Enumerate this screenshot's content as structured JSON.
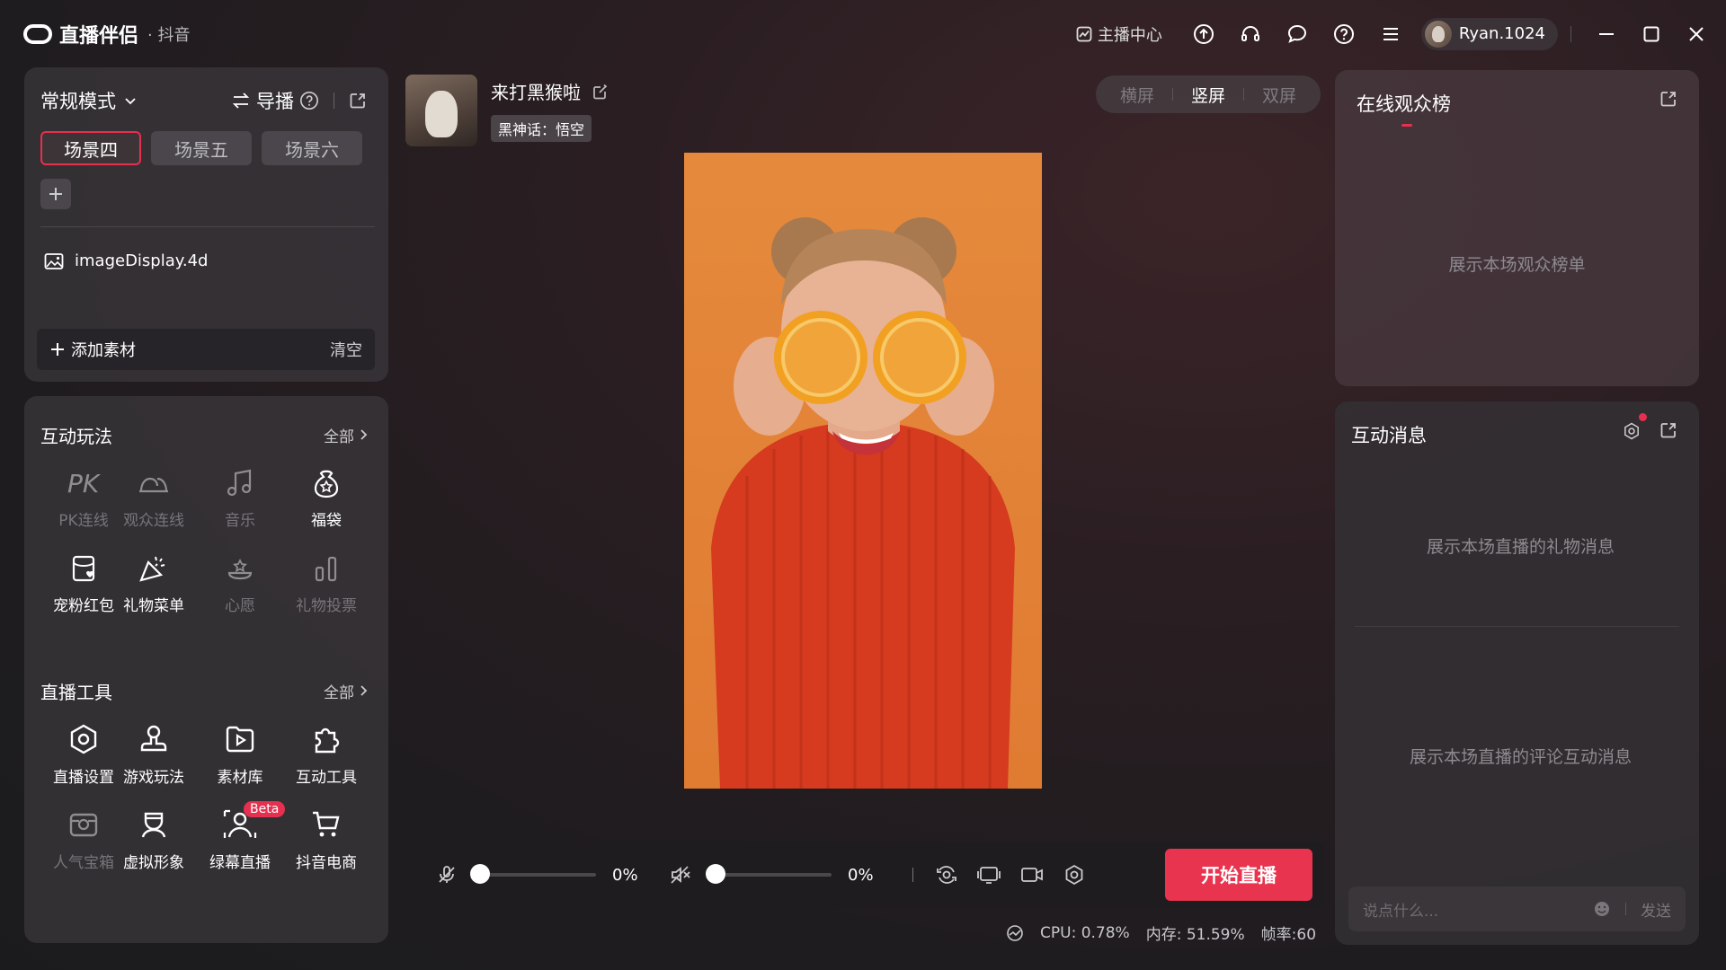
{
  "app": {
    "name": "直播伴侣",
    "platform": "· 抖音"
  },
  "titlebar": {
    "host_center": "主播中心",
    "username": "Ryan.1024"
  },
  "scenes": {
    "mode": "常规模式",
    "director": "导播",
    "tabs": [
      "场景四",
      "场景五",
      "场景六"
    ],
    "active_tab": "场景四",
    "source": "imageDisplay.4d",
    "add_source": "添加素材",
    "clear": "清空"
  },
  "interactive": {
    "title": "互动玩法",
    "all": "全部",
    "items": [
      {
        "label": "PK连线",
        "icon": "pk-icon",
        "enabled": false
      },
      {
        "label": "观众连线",
        "icon": "audience-link-icon",
        "enabled": false
      },
      {
        "label": "音乐",
        "icon": "music-icon",
        "enabled": false
      },
      {
        "label": "福袋",
        "icon": "lucky-bag-icon",
        "enabled": true
      },
      {
        "label": "宠粉红包",
        "icon": "red-packet-icon",
        "enabled": true
      },
      {
        "label": "礼物菜单",
        "icon": "gift-menu-icon",
        "enabled": true
      },
      {
        "label": "心愿",
        "icon": "wish-icon",
        "enabled": false
      },
      {
        "label": "礼物投票",
        "icon": "gift-vote-icon",
        "enabled": false
      }
    ]
  },
  "tools": {
    "title": "直播工具",
    "all": "全部",
    "items": [
      {
        "label": "直播设置",
        "icon": "live-settings-icon",
        "enabled": true
      },
      {
        "label": "游戏玩法",
        "icon": "game-play-icon",
        "enabled": true
      },
      {
        "label": "素材库",
        "icon": "asset-library-icon",
        "enabled": true
      },
      {
        "label": "互动工具",
        "icon": "interactive-tools-icon",
        "enabled": true
      },
      {
        "label": "人气宝箱",
        "icon": "treasure-box-icon",
        "enabled": false
      },
      {
        "label": "虚拟形象",
        "icon": "avatar-icon",
        "enabled": true
      },
      {
        "label": "绿幕直播",
        "icon": "green-screen-icon",
        "enabled": true,
        "badge": "Beta"
      },
      {
        "label": "抖音电商",
        "icon": "shop-cart-icon",
        "enabled": true
      }
    ]
  },
  "streamer": {
    "name": "来打黑猴啦",
    "category": "黑神话：悟空"
  },
  "orientation": {
    "options": [
      "横屏",
      "竖屏",
      "双屏"
    ],
    "selected": "竖屏"
  },
  "controls": {
    "mic_volume": "0%",
    "speaker_volume": "0%",
    "mic_level": 0,
    "speaker_level": 0,
    "go_live": "开始直播"
  },
  "stats": {
    "cpu": "CPU: 0.78%",
    "memory": "内存: 51.59%",
    "fps": "帧率:60"
  },
  "rank": {
    "title": "在线观众榜",
    "placeholder": "展示本场观众榜单"
  },
  "messages": {
    "title": "互动消息",
    "gift_placeholder": "展示本场直播的礼物消息",
    "comment_placeholder": "展示本场直播的评论互动消息",
    "input_placeholder": "说点什么...",
    "send": "发送"
  },
  "colors": {
    "accent": "#e8344f",
    "panel": "#373438",
    "background": "#1f1c1f"
  }
}
